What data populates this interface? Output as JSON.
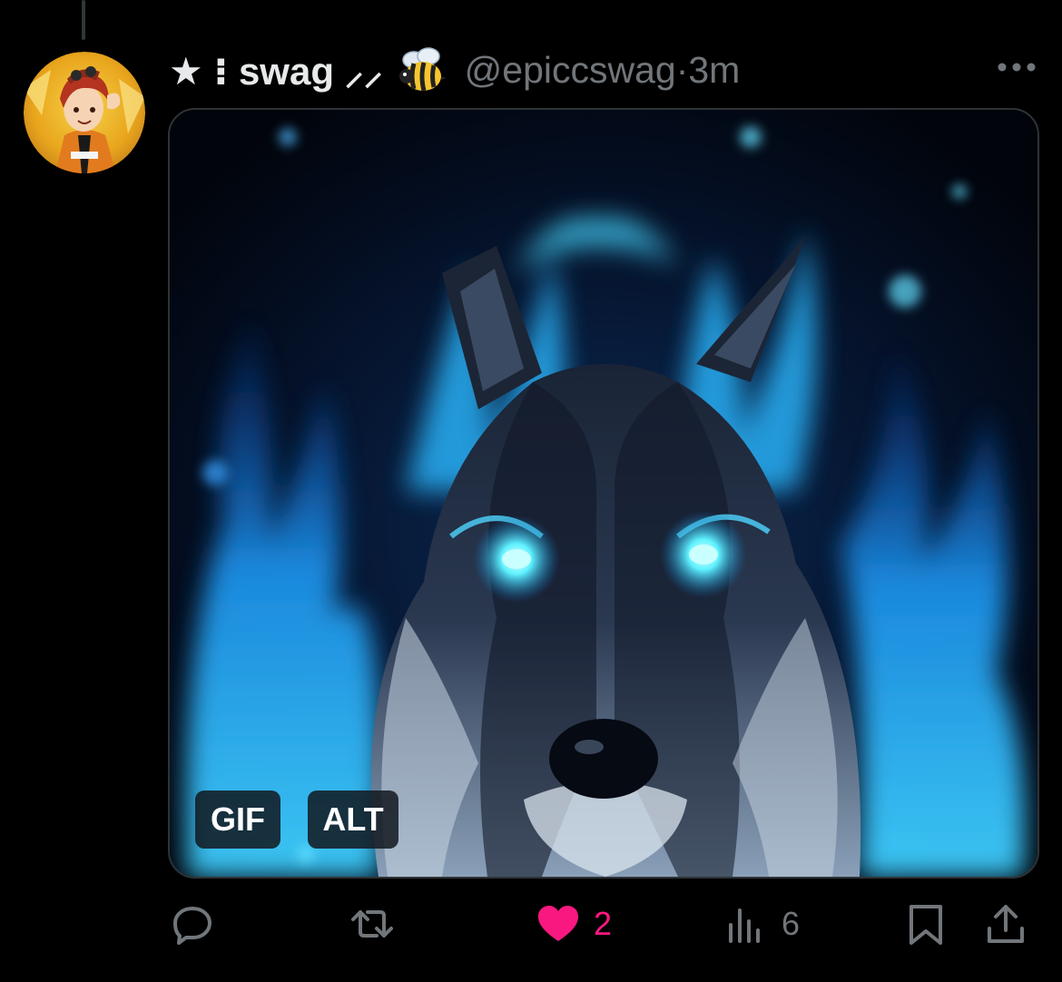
{
  "tweet": {
    "display_name": "★ ⁝ swag ⸝⸝",
    "emoji_icon": "bee-icon",
    "handle": "@epiccswag",
    "separator": "·",
    "time": "3m"
  },
  "media": {
    "type": "animated gif",
    "badges": {
      "gif": "GIF",
      "alt": "ALT"
    }
  },
  "actions": {
    "reply_count": "",
    "retweet_count": "",
    "like_count": "2",
    "views_count": "6"
  },
  "colors": {
    "background": "#000000",
    "text_primary": "#e7e9ea",
    "text_secondary": "#71767b",
    "like_active": "#f91880",
    "border": "#2f3336"
  }
}
